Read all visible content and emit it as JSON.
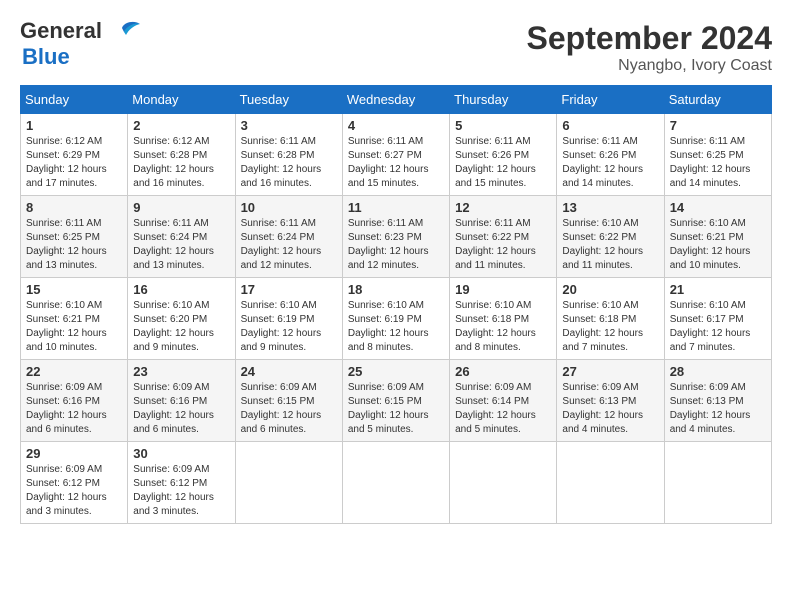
{
  "header": {
    "logo_general": "General",
    "logo_blue": "Blue",
    "month_title": "September 2024",
    "location": "Nyangbo, Ivory Coast"
  },
  "days_of_week": [
    "Sunday",
    "Monday",
    "Tuesday",
    "Wednesday",
    "Thursday",
    "Friday",
    "Saturday"
  ],
  "weeks": [
    [
      {
        "day": "1",
        "sunrise": "6:12 AM",
        "sunset": "6:29 PM",
        "daylight": "12 hours and 17 minutes."
      },
      {
        "day": "2",
        "sunrise": "6:12 AM",
        "sunset": "6:28 PM",
        "daylight": "12 hours and 16 minutes."
      },
      {
        "day": "3",
        "sunrise": "6:11 AM",
        "sunset": "6:28 PM",
        "daylight": "12 hours and 16 minutes."
      },
      {
        "day": "4",
        "sunrise": "6:11 AM",
        "sunset": "6:27 PM",
        "daylight": "12 hours and 15 minutes."
      },
      {
        "day": "5",
        "sunrise": "6:11 AM",
        "sunset": "6:26 PM",
        "daylight": "12 hours and 15 minutes."
      },
      {
        "day": "6",
        "sunrise": "6:11 AM",
        "sunset": "6:26 PM",
        "daylight": "12 hours and 14 minutes."
      },
      {
        "day": "7",
        "sunrise": "6:11 AM",
        "sunset": "6:25 PM",
        "daylight": "12 hours and 14 minutes."
      }
    ],
    [
      {
        "day": "8",
        "sunrise": "6:11 AM",
        "sunset": "6:25 PM",
        "daylight": "12 hours and 13 minutes."
      },
      {
        "day": "9",
        "sunrise": "6:11 AM",
        "sunset": "6:24 PM",
        "daylight": "12 hours and 13 minutes."
      },
      {
        "day": "10",
        "sunrise": "6:11 AM",
        "sunset": "6:24 PM",
        "daylight": "12 hours and 12 minutes."
      },
      {
        "day": "11",
        "sunrise": "6:11 AM",
        "sunset": "6:23 PM",
        "daylight": "12 hours and 12 minutes."
      },
      {
        "day": "12",
        "sunrise": "6:11 AM",
        "sunset": "6:22 PM",
        "daylight": "12 hours and 11 minutes."
      },
      {
        "day": "13",
        "sunrise": "6:10 AM",
        "sunset": "6:22 PM",
        "daylight": "12 hours and 11 minutes."
      },
      {
        "day": "14",
        "sunrise": "6:10 AM",
        "sunset": "6:21 PM",
        "daylight": "12 hours and 10 minutes."
      }
    ],
    [
      {
        "day": "15",
        "sunrise": "6:10 AM",
        "sunset": "6:21 PM",
        "daylight": "12 hours and 10 minutes."
      },
      {
        "day": "16",
        "sunrise": "6:10 AM",
        "sunset": "6:20 PM",
        "daylight": "12 hours and 9 minutes."
      },
      {
        "day": "17",
        "sunrise": "6:10 AM",
        "sunset": "6:19 PM",
        "daylight": "12 hours and 9 minutes."
      },
      {
        "day": "18",
        "sunrise": "6:10 AM",
        "sunset": "6:19 PM",
        "daylight": "12 hours and 8 minutes."
      },
      {
        "day": "19",
        "sunrise": "6:10 AM",
        "sunset": "6:18 PM",
        "daylight": "12 hours and 8 minutes."
      },
      {
        "day": "20",
        "sunrise": "6:10 AM",
        "sunset": "6:18 PM",
        "daylight": "12 hours and 7 minutes."
      },
      {
        "day": "21",
        "sunrise": "6:10 AM",
        "sunset": "6:17 PM",
        "daylight": "12 hours and 7 minutes."
      }
    ],
    [
      {
        "day": "22",
        "sunrise": "6:09 AM",
        "sunset": "6:16 PM",
        "daylight": "12 hours and 6 minutes."
      },
      {
        "day": "23",
        "sunrise": "6:09 AM",
        "sunset": "6:16 PM",
        "daylight": "12 hours and 6 minutes."
      },
      {
        "day": "24",
        "sunrise": "6:09 AM",
        "sunset": "6:15 PM",
        "daylight": "12 hours and 6 minutes."
      },
      {
        "day": "25",
        "sunrise": "6:09 AM",
        "sunset": "6:15 PM",
        "daylight": "12 hours and 5 minutes."
      },
      {
        "day": "26",
        "sunrise": "6:09 AM",
        "sunset": "6:14 PM",
        "daylight": "12 hours and 5 minutes."
      },
      {
        "day": "27",
        "sunrise": "6:09 AM",
        "sunset": "6:13 PM",
        "daylight": "12 hours and 4 minutes."
      },
      {
        "day": "28",
        "sunrise": "6:09 AM",
        "sunset": "6:13 PM",
        "daylight": "12 hours and 4 minutes."
      }
    ],
    [
      {
        "day": "29",
        "sunrise": "6:09 AM",
        "sunset": "6:12 PM",
        "daylight": "12 hours and 3 minutes."
      },
      {
        "day": "30",
        "sunrise": "6:09 AM",
        "sunset": "6:12 PM",
        "daylight": "12 hours and 3 minutes."
      },
      null,
      null,
      null,
      null,
      null
    ]
  ],
  "labels": {
    "sunrise": "Sunrise:",
    "sunset": "Sunset:",
    "daylight": "Daylight:"
  }
}
